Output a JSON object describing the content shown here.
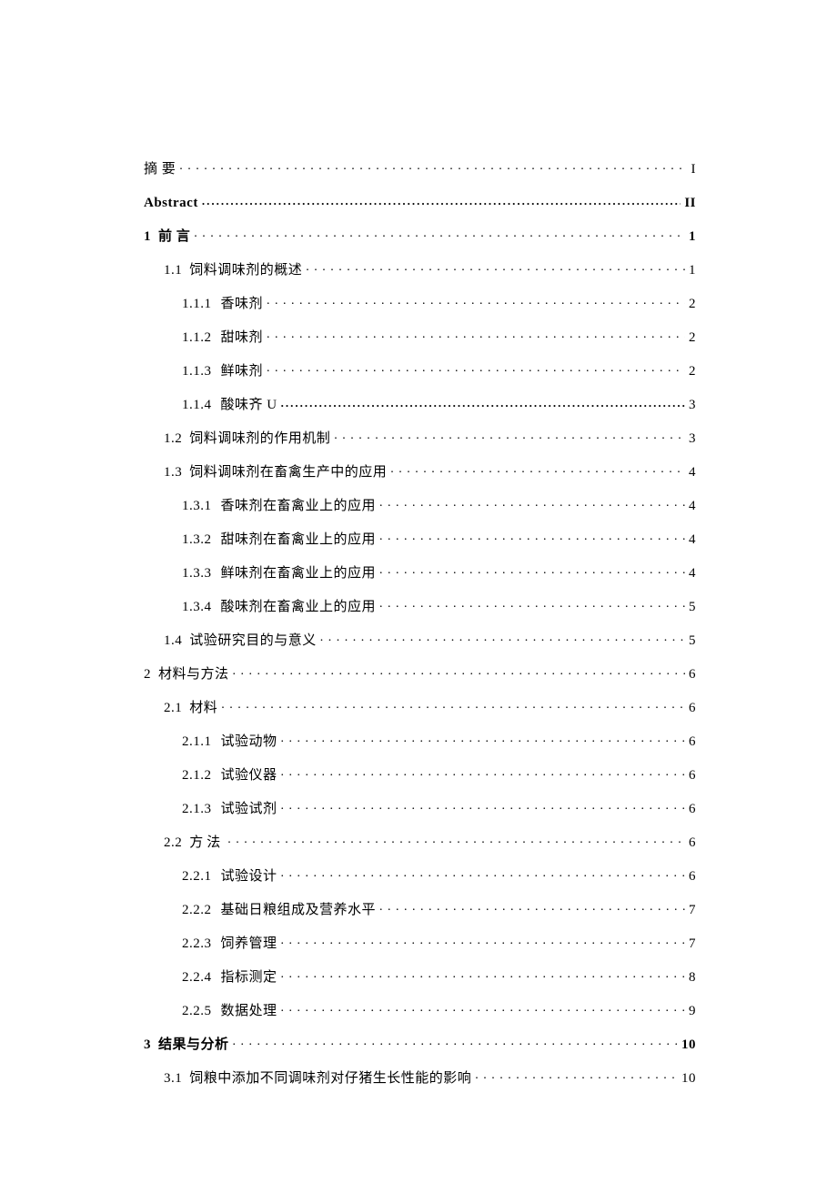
{
  "toc": [
    {
      "level": 0,
      "bold": false,
      "num": "",
      "title": "摘 要",
      "page": "I",
      "boldLeader": false,
      "spaced": false
    },
    {
      "level": 0,
      "bold": true,
      "num": "",
      "title": "Abstract",
      "page": "II",
      "boldLeader": true,
      "spaced": false,
      "en": true
    },
    {
      "level": 0,
      "bold": true,
      "num": "1",
      "title": "前 言",
      "page": "1",
      "boldLeader": false,
      "spaced": false
    },
    {
      "level": 1,
      "bold": false,
      "num": "1.1",
      "title": "饲料调味剂的概述",
      "page": "1",
      "boldLeader": false,
      "spaced": false
    },
    {
      "level": 2,
      "bold": false,
      "num": "1.1.1",
      "title": "香味剂",
      "page": "2",
      "boldLeader": false,
      "spaced": false
    },
    {
      "level": 2,
      "bold": false,
      "num": "1.1.2",
      "title": "甜味剂",
      "page": "2",
      "boldLeader": false,
      "spaced": false
    },
    {
      "level": 2,
      "bold": false,
      "num": "1.1.3",
      "title": "鲜味剂",
      "page": "2",
      "boldLeader": false,
      "spaced": false
    },
    {
      "level": 2,
      "bold": false,
      "num": "1.1.4",
      "title": "酸味齐 U",
      "page": "3",
      "boldLeader": true,
      "spaced": false
    },
    {
      "level": 1,
      "bold": false,
      "num": "1.2",
      "title": "饲料调味剂的作用机制",
      "page": "3",
      "boldLeader": false,
      "spaced": false
    },
    {
      "level": 1,
      "bold": false,
      "num": "1.3",
      "title": "饲料调味剂在畜禽生产中的应用",
      "page": "4",
      "boldLeader": false,
      "spaced": false
    },
    {
      "level": 2,
      "bold": false,
      "num": "1.3.1",
      "title": "香味剂在畜禽业上的应用",
      "page": "4",
      "boldLeader": false,
      "spaced": false
    },
    {
      "level": 2,
      "bold": false,
      "num": "1.3.2",
      "title": "甜味剂在畜禽业上的应用",
      "page": "4",
      "boldLeader": false,
      "spaced": false
    },
    {
      "level": 2,
      "bold": false,
      "num": "1.3.3",
      "title": "鲜味剂在畜禽业上的应用",
      "page": "4",
      "boldLeader": false,
      "spaced": false
    },
    {
      "level": 2,
      "bold": false,
      "num": "1.3.4",
      "title": "酸味剂在畜禽业上的应用",
      "page": "5",
      "boldLeader": false,
      "spaced": false
    },
    {
      "level": 1,
      "bold": false,
      "num": "1.4",
      "title": "试验研究目的与意义",
      "page": "5",
      "boldLeader": false,
      "spaced": false
    },
    {
      "level": 0,
      "bold": false,
      "num": "2",
      "title": "材料与方法",
      "page": "6",
      "boldLeader": false,
      "spaced": false
    },
    {
      "level": 1,
      "bold": false,
      "num": "2.1",
      "title": "材料",
      "page": "6",
      "boldLeader": false,
      "spaced": false
    },
    {
      "level": 2,
      "bold": false,
      "num": "2.1.1",
      "title": "试验动物",
      "page": "6",
      "boldLeader": false,
      "spaced": false
    },
    {
      "level": 2,
      "bold": false,
      "num": "2.1.2",
      "title": "试验仪器",
      "page": "6",
      "boldLeader": false,
      "spaced": false
    },
    {
      "level": 2,
      "bold": false,
      "num": "2.1.3",
      "title": "试验试剂",
      "page": "6",
      "boldLeader": false,
      "spaced": false
    },
    {
      "level": 1,
      "bold": false,
      "num": "2.2",
      "title": "方法",
      "page": "6",
      "boldLeader": false,
      "spaced": true
    },
    {
      "level": 2,
      "bold": false,
      "num": "2.2.1",
      "title": "试验设计",
      "page": "6",
      "boldLeader": false,
      "spaced": false
    },
    {
      "level": 2,
      "bold": false,
      "num": "2.2.2",
      "title": "基础日粮组成及营养水平",
      "page": "7",
      "boldLeader": false,
      "spaced": false
    },
    {
      "level": 2,
      "bold": false,
      "num": "2.2.3",
      "title": "饲养管理",
      "page": "7",
      "boldLeader": false,
      "spaced": false
    },
    {
      "level": 2,
      "bold": false,
      "num": "2.2.4",
      "title": "指标测定",
      "page": "8",
      "boldLeader": false,
      "spaced": false
    },
    {
      "level": 2,
      "bold": false,
      "num": "2.2.5",
      "title": "数据处理",
      "page": "9",
      "boldLeader": false,
      "spaced": false
    },
    {
      "level": 0,
      "bold": true,
      "num": "3",
      "title": "结果与分析",
      "page": "10",
      "boldLeader": false,
      "spaced": false
    },
    {
      "level": 1,
      "bold": false,
      "num": "3.1",
      "title": "饲粮中添加不同调味剂对仔猪生长性能的影响",
      "page": "10",
      "boldLeader": false,
      "spaced": false
    }
  ]
}
